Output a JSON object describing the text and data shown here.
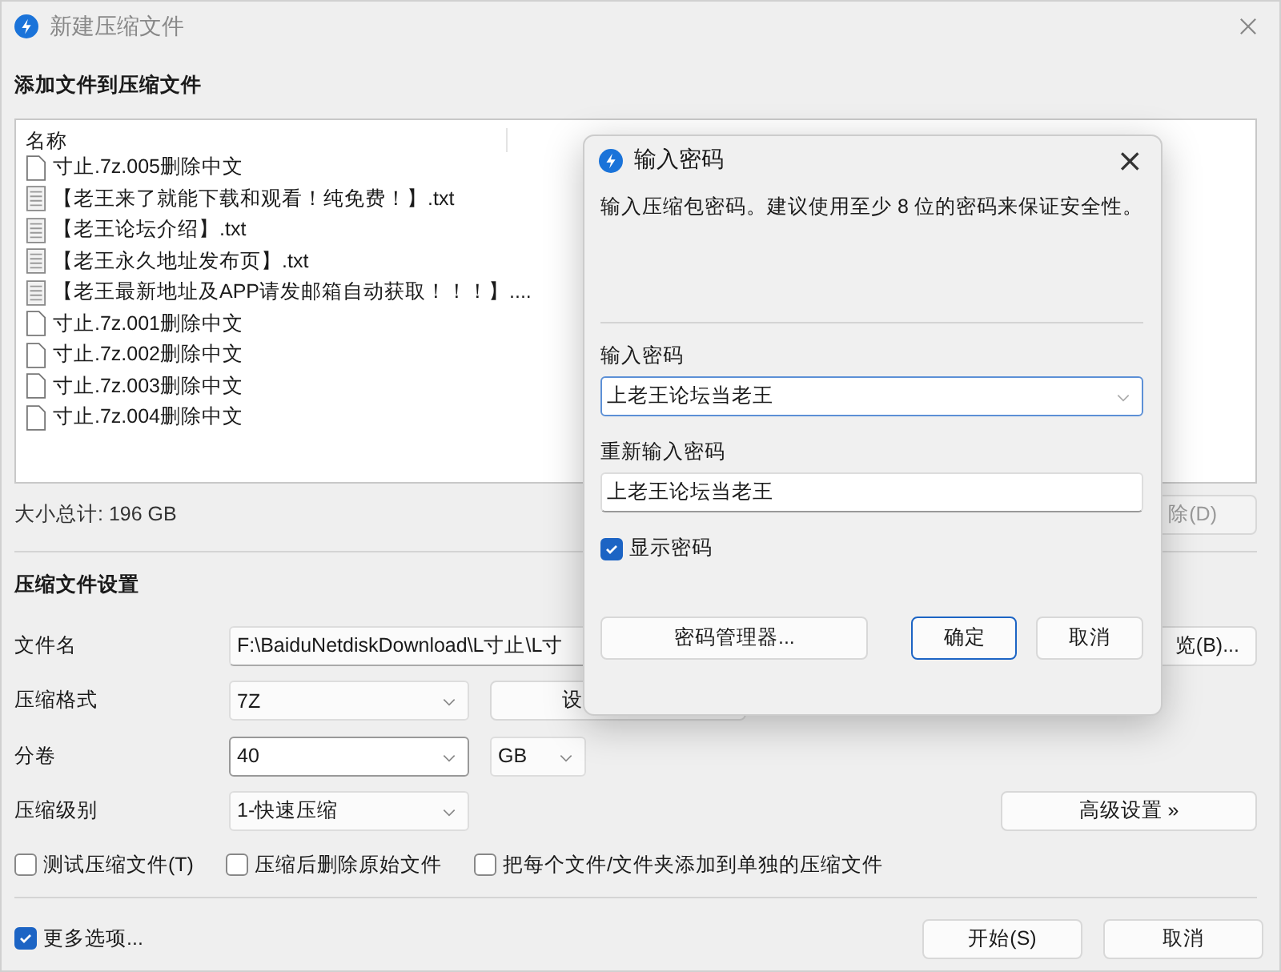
{
  "window": {
    "title": "新建压缩文件"
  },
  "files_section": {
    "heading": "添加文件到压缩文件",
    "column": "名称",
    "rows": [
      {
        "name": "寸止.7z.005删除中文",
        "kind": "file"
      },
      {
        "name": "【老王来了就能下载和观看！纯免费！】.txt",
        "kind": "text"
      },
      {
        "name": "【老王论坛介绍】.txt",
        "kind": "text"
      },
      {
        "name": "【老王永久地址发布页】.txt",
        "kind": "text"
      },
      {
        "name": "【老王最新地址及APP请发邮箱自动获取！！！】....",
        "kind": "text"
      },
      {
        "name": "寸止.7z.001删除中文",
        "kind": "file"
      },
      {
        "name": "寸止.7z.002删除中文",
        "kind": "file"
      },
      {
        "name": "寸止.7z.003删除中文",
        "kind": "file"
      },
      {
        "name": "寸止.7z.004删除中文",
        "kind": "file"
      }
    ],
    "total": "大小总计: 196 GB",
    "delete_button": "除(D)"
  },
  "settings": {
    "heading": "压缩文件设置",
    "filename": {
      "label": "文件名",
      "value": "F:\\BaiduNetdiskDownload\\L寸止\\L寸",
      "browse_button": "览(B)..."
    },
    "format": {
      "label": "压缩格式",
      "value": "7Z",
      "button": "设"
    },
    "volume": {
      "label": "分卷",
      "value": "40",
      "unit": "GB"
    },
    "level": {
      "label": "压缩级别",
      "value": "1-快速压缩",
      "button": "高级设置 »"
    },
    "options": [
      {
        "label": "测试压缩文件(T)",
        "checked": false
      },
      {
        "label": "压缩后删除原始文件",
        "checked": false
      },
      {
        "label": "把每个文件/文件夹添加到单独的压缩文件",
        "checked": false
      }
    ]
  },
  "footer": {
    "more": {
      "label": "更多选项...",
      "checked": true
    },
    "buttons": [
      {
        "label": "开始(S)",
        "default": false
      },
      {
        "label": "取消",
        "default": false
      }
    ]
  },
  "dialog": {
    "title": "输入密码",
    "close": "×",
    "description": "输入压缩包密码。建议使用至少 8 位的密码来保证安全性。",
    "password": {
      "label": "输入密码",
      "value": "上老王论坛当老王",
      "focused": true
    },
    "confirm": {
      "label": "重新输入密码",
      "value": "上老王论坛当老王",
      "focused": false
    },
    "show_password": {
      "label": "显示密码",
      "checked": true
    },
    "buttons": [
      {
        "label": "密码管理器...",
        "default": false
      },
      {
        "label": "确定",
        "default": true
      },
      {
        "label": "取消",
        "default": false
      }
    ]
  }
}
